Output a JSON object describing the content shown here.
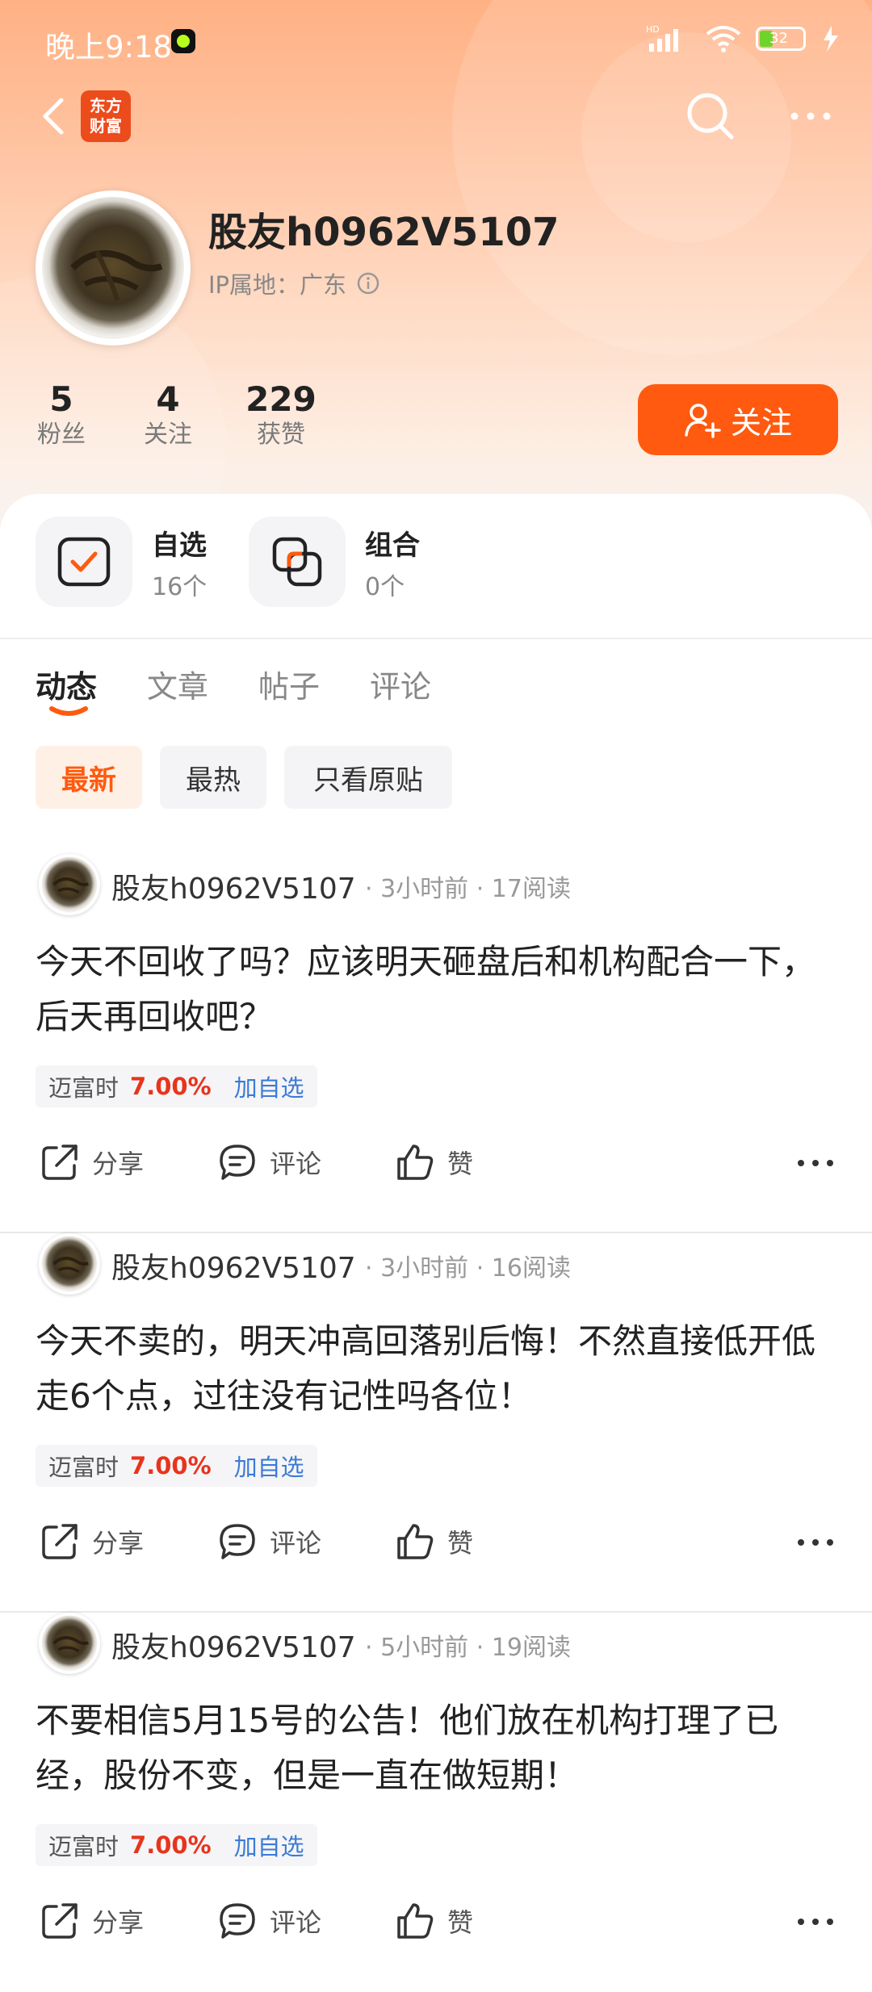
{
  "status_bar": {
    "time": "晚上9:18",
    "battery": "32"
  },
  "profile": {
    "app_logo_line1": "东方",
    "app_logo_line2": "财富",
    "username": "股友h0962V5107",
    "ip_location": "IP属地：广东"
  },
  "stats": [
    {
      "value": "5",
      "label": "粉丝"
    },
    {
      "value": "4",
      "label": "关注"
    },
    {
      "value": "229",
      "label": "获赞"
    }
  ],
  "follow_button": "关注",
  "quick": [
    {
      "title": "自选",
      "count": "16个"
    },
    {
      "title": "组合",
      "count": "0个"
    }
  ],
  "tabs": [
    "动态",
    "文章",
    "帖子",
    "评论"
  ],
  "active_tab": 0,
  "filters": [
    "最新",
    "最热",
    "只看原贴"
  ],
  "active_filter": 0,
  "posts": [
    {
      "author": "股友h0962V5107",
      "meta": "· 3小时前 · 17阅读",
      "text": "今天不回收了吗？应该明天砸盘后和机构配合一下，后天再回收吧？",
      "stock_name": "迈富时",
      "stock_change": "7.00%",
      "stock_add": "加自选",
      "share": "分享",
      "comment": "评论",
      "like": "赞"
    },
    {
      "author": "股友h0962V5107",
      "meta": "· 3小时前 · 16阅读",
      "text": "今天不卖的，明天冲高回落别后悔！不然直接低开低走6个点，过往没有记性吗各位！",
      "stock_name": "迈富时",
      "stock_change": "7.00%",
      "stock_add": "加自选",
      "share": "分享",
      "comment": "评论",
      "like": "赞"
    },
    {
      "author": "股友h0962V5107",
      "meta": "· 5小时前 · 19阅读",
      "text": "不要相信5月15号的公告！他们放在机构打理了已经，股份不变，但是一直在做短期！",
      "stock_name": "迈富时",
      "stock_change": "7.00%",
      "stock_add": "加自选",
      "share": "分享",
      "comment": "评论",
      "like": "赞"
    }
  ],
  "colors": {
    "accent": "#ff5a0f",
    "stock_up": "#e8341c",
    "link": "#3b7ad6"
  }
}
